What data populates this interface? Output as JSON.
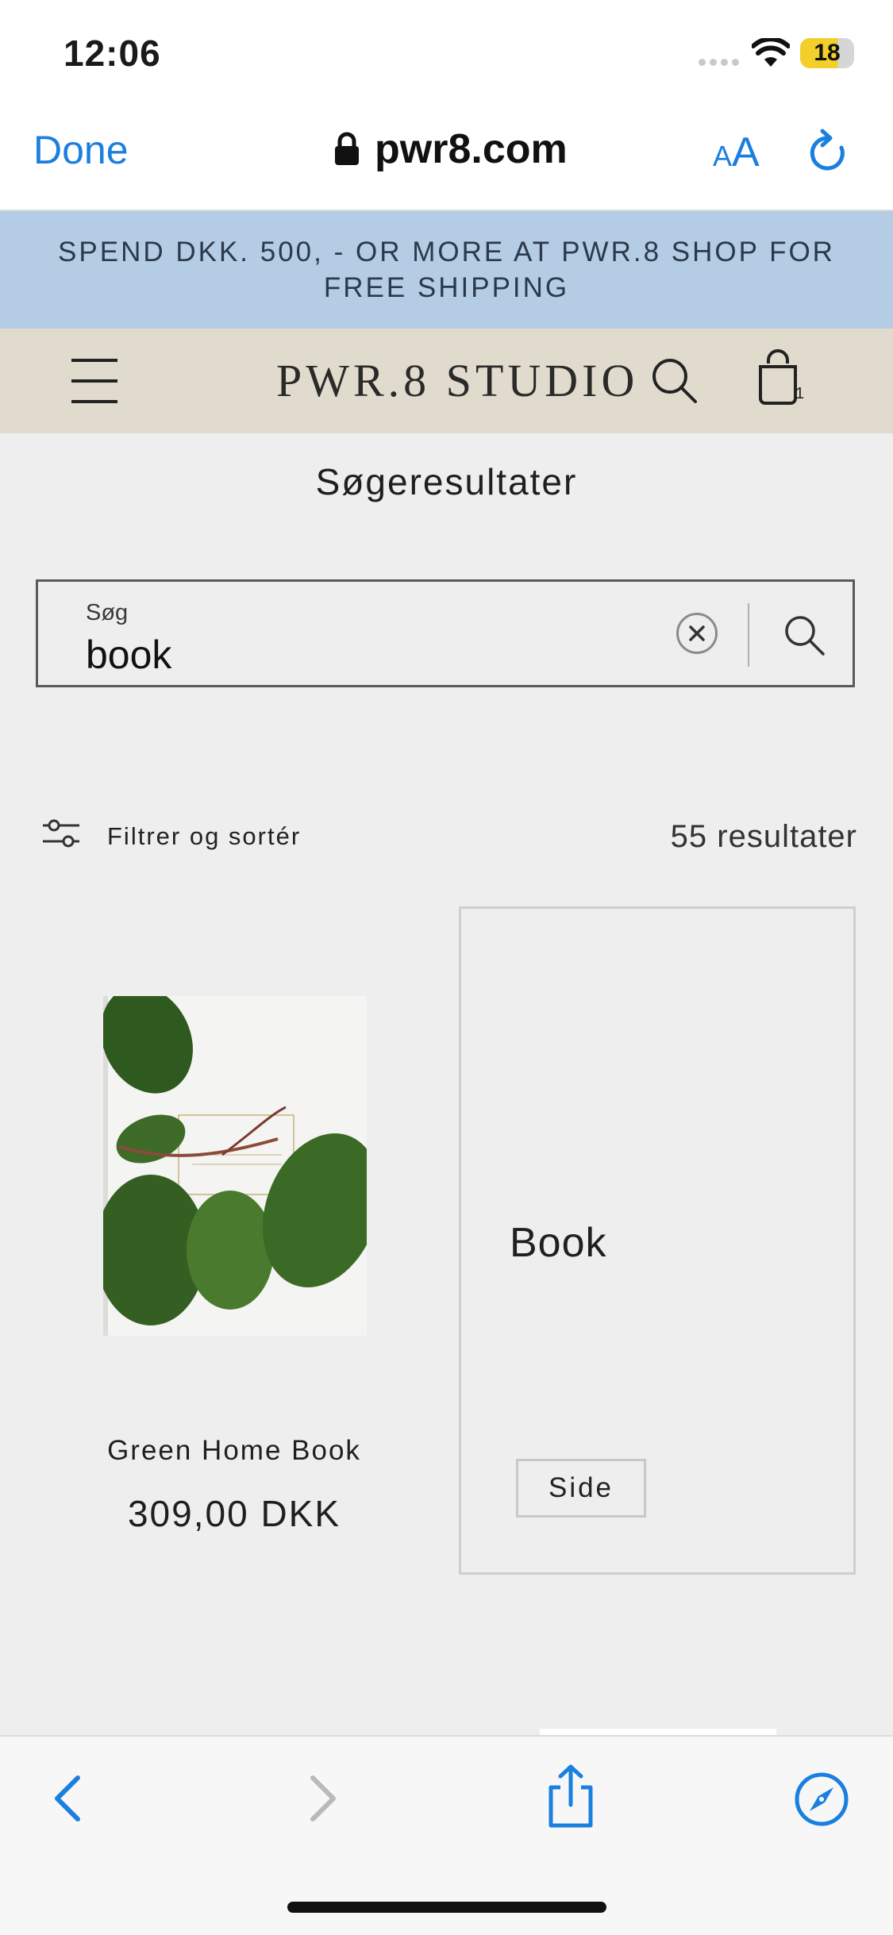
{
  "status_bar": {
    "time": "12:06",
    "battery": "18"
  },
  "safari": {
    "done_label": "Done",
    "url": "pwr8.com",
    "text_size_small": "A",
    "text_size_big": "A"
  },
  "promo": {
    "text": "SPEND DKK. 500, - OR MORE AT PWR.8 SHOP FOR FREE SHIPPING"
  },
  "header": {
    "logo": "PWR.8 STUDIO",
    "cart_count": "1"
  },
  "page": {
    "title": "Søgeresultater"
  },
  "search": {
    "label": "Søg",
    "value": "book"
  },
  "results": {
    "filter_label": "Filtrer og sortér",
    "count_text": "55 resultater"
  },
  "products": [
    {
      "name": "Green Home Book",
      "price": "309,00 DKK"
    }
  ],
  "pages": [
    {
      "title": "Book",
      "tag": "Side"
    }
  ],
  "colors": {
    "accent": "#1b7fe0",
    "banner": "#b4cce4",
    "header": "#e0dbcc",
    "page_bg": "#efeeef"
  },
  "icons": [
    "lock-icon",
    "menu-icon",
    "search-icon",
    "cart-icon",
    "clear-icon",
    "filter-icon",
    "back-icon",
    "forward-icon",
    "share-icon",
    "compass-icon",
    "reload-icon"
  ]
}
